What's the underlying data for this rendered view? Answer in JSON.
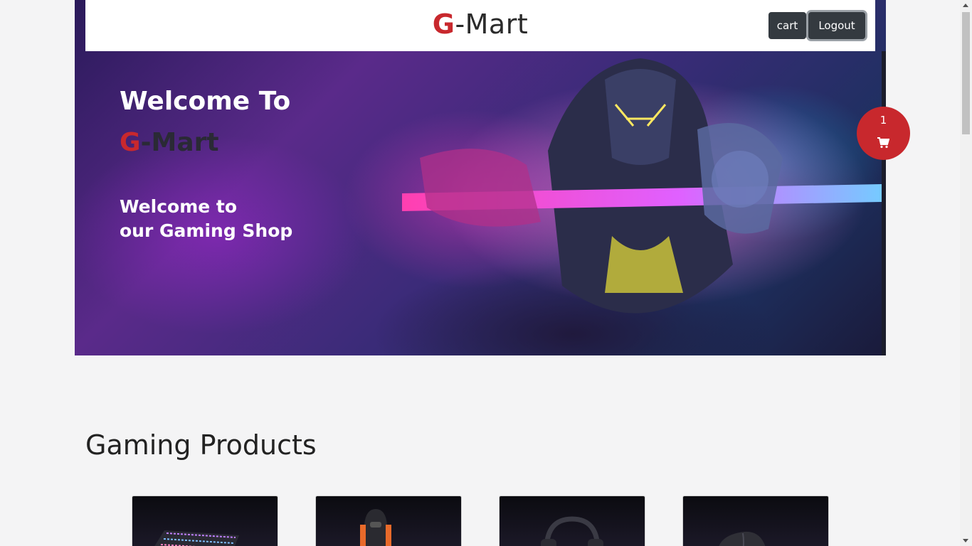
{
  "header": {
    "brand_letter": "G",
    "brand_rest": "-Mart",
    "cart_label": "cart",
    "logout_label": "Logout"
  },
  "hero": {
    "title": "Welcome To",
    "brand_letter": "G",
    "brand_rest": "-Mart",
    "subtitle_line1": "Welcome to",
    "subtitle_line2": "our Gaming Shop"
  },
  "floating_cart": {
    "count": "1",
    "icon": "shopping-cart-icon"
  },
  "products": {
    "section_title": "Gaming Products",
    "items": [
      {
        "icon": "keyboard-icon"
      },
      {
        "icon": "gaming-chair-icon"
      },
      {
        "icon": "headphones-icon"
      },
      {
        "icon": "mouse-icon"
      }
    ]
  },
  "colors": {
    "brand_red": "#c8282d",
    "button_dark": "#343a40",
    "page_bg": "#f4f4f5"
  }
}
